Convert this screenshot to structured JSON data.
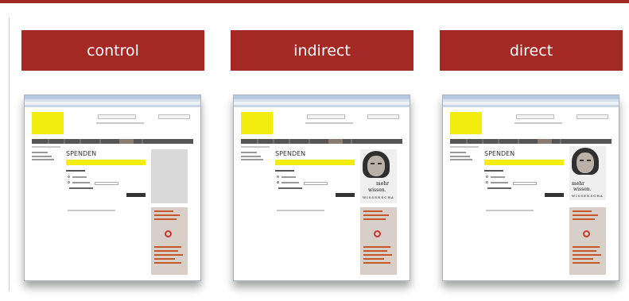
{
  "panels": [
    {
      "label": "control"
    },
    {
      "label": "indirect"
    },
    {
      "label": "direct"
    }
  ],
  "screenshot": {
    "page_heading": "SPENDEN"
  },
  "poster": {
    "line1": "mehr",
    "line2": "wissen.",
    "line3": "WISSENSCHA"
  },
  "colors": {
    "header_red": "#a42824",
    "logo_yellow": "#f2ed0f"
  }
}
